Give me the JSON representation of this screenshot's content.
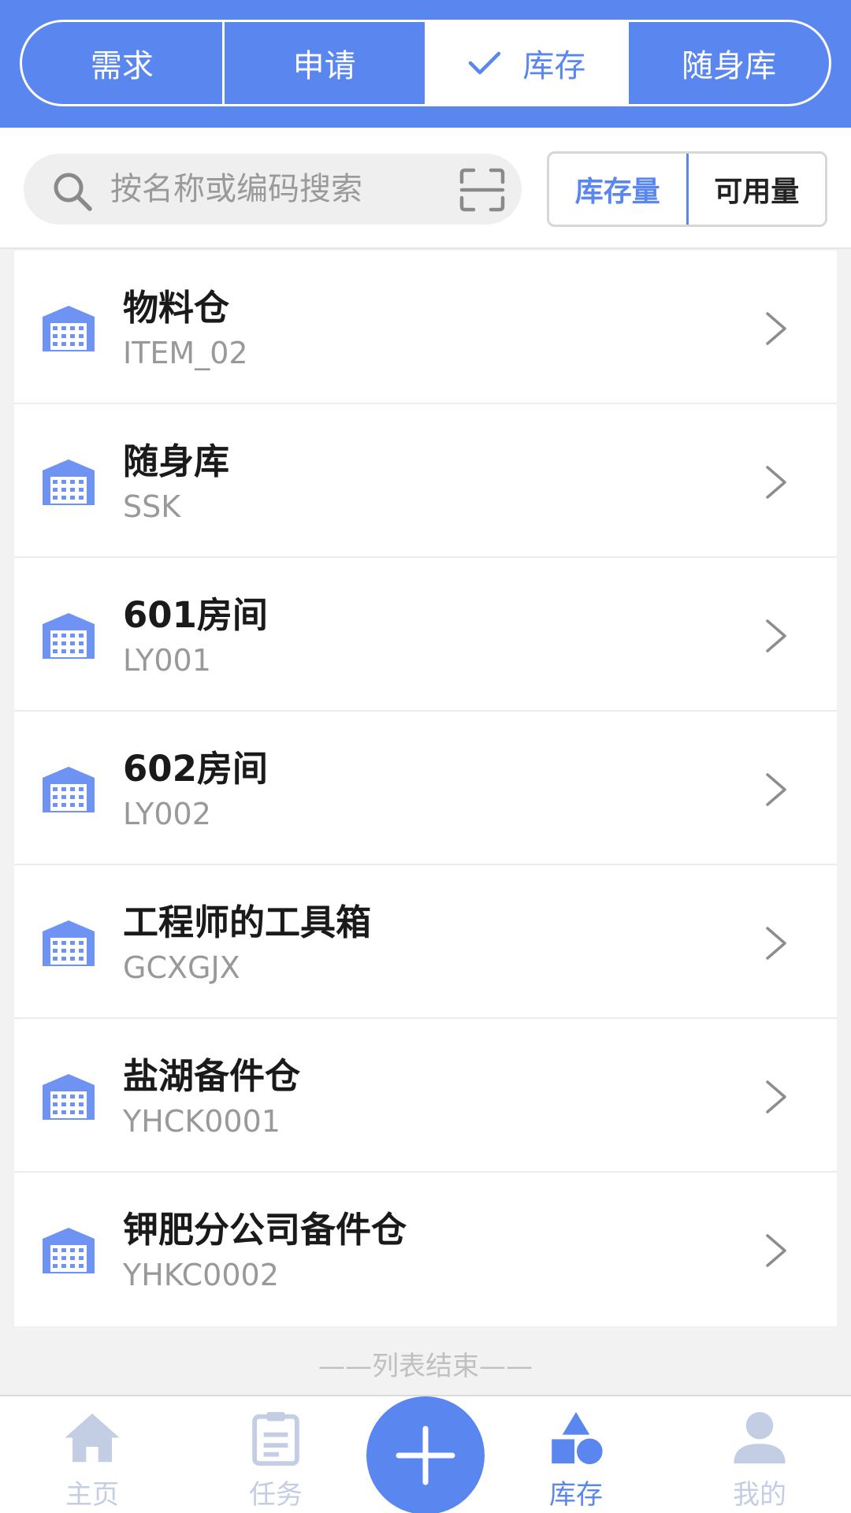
{
  "tabs": [
    {
      "label": "需求",
      "active": false
    },
    {
      "label": "申请",
      "active": false
    },
    {
      "label": "库存",
      "active": true
    },
    {
      "label": "随身库",
      "active": false
    }
  ],
  "search": {
    "placeholder": "按名称或编码搜索",
    "value": ""
  },
  "qty_toggle": {
    "stock_label": "库存量",
    "available_label": "可用量",
    "selected": "库存量"
  },
  "warehouses": [
    {
      "name": "物料仓",
      "code": "ITEM_02"
    },
    {
      "name": "随身库",
      "code": "SSK"
    },
    {
      "name": "601房间",
      "code": "LY001"
    },
    {
      "name": "602房间",
      "code": "LY002"
    },
    {
      "name": "工程师的工具箱",
      "code": "GCXGJX"
    },
    {
      "name": "盐湖备件仓",
      "code": "YHCK0001"
    },
    {
      "name": "钾肥分公司备件仓",
      "code": "YHKC0002"
    }
  ],
  "list_end_text": "——列表结束——",
  "bottom_nav": {
    "home": "主页",
    "tasks": "任务",
    "inventory": "库存",
    "mine": "我的",
    "active": "库存"
  },
  "colors": {
    "accent": "#5a86f0",
    "inactive_nav": "#c3cde3",
    "code_text": "#999999"
  },
  "icons": {
    "tab_check": "check-icon",
    "search": "search-icon",
    "scan": "scan-icon",
    "list_item": "warehouse-icon",
    "list_arrow": "chevron-right-icon",
    "fab": "plus-icon"
  }
}
